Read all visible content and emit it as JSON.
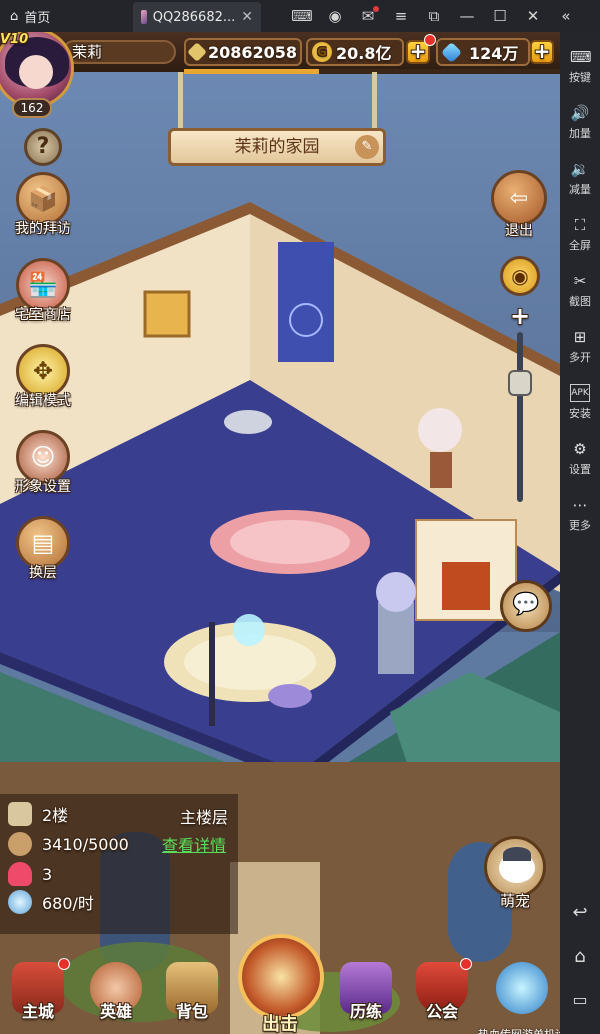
{
  "emulator": {
    "home_label": "首页",
    "tab_title": "QQ286682...",
    "tab_close": "✕",
    "window_icons": [
      "gamepad-icon",
      "user-icon",
      "mail-icon",
      "menu-icon",
      "popout-icon",
      "minimize-icon",
      "maximize-icon",
      "close-icon",
      "collapse-icon"
    ],
    "side_items": [
      {
        "label": "按键",
        "icon": "keyboard-icon"
      },
      {
        "label": "加量",
        "icon": "volume-up-icon"
      },
      {
        "label": "减量",
        "icon": "volume-down-icon"
      },
      {
        "label": "全屏",
        "icon": "fullscreen-icon"
      },
      {
        "label": "截图",
        "icon": "scissors-icon"
      },
      {
        "label": "多开",
        "icon": "multi-instance-icon"
      },
      {
        "label": "安装",
        "icon": "apk-icon"
      },
      {
        "label": "设置",
        "icon": "gear-icon"
      },
      {
        "label": "更多",
        "icon": "more-icon"
      }
    ],
    "nav_icons": [
      "back-icon",
      "home-icon",
      "recent-apps-icon"
    ]
  },
  "player": {
    "vip": "V10",
    "name": "茉莉",
    "level": "162",
    "power": "20862058",
    "gold": "20.8亿",
    "gems": "124万",
    "xp_fraction": 0.36
  },
  "room": {
    "title": "茉莉的家园"
  },
  "left_menu": [
    {
      "label": "我的拜访",
      "icon": "visit-icon"
    },
    {
      "label": "宅室商店",
      "icon": "shop-icon"
    },
    {
      "label": "编辑模式",
      "icon": "move-arrows-icon"
    },
    {
      "label": "形象设置",
      "icon": "portrait-icon"
    },
    {
      "label": "换层",
      "icon": "stairs-icon"
    }
  ],
  "right_controls": {
    "exit_label": "退出",
    "zoom_plus": "+",
    "zoom_fraction": 0.7
  },
  "floor_info": {
    "floor": "2楼",
    "floor_type": "主楼层",
    "capacity": "3410/5000",
    "detail_link": "查看详情",
    "hearts": "3",
    "rate": "680/时"
  },
  "pet": {
    "label": "萌宠"
  },
  "bottom_nav": [
    {
      "label": "主城"
    },
    {
      "label": "英雄"
    },
    {
      "label": "背包"
    },
    {
      "label": "出击"
    },
    {
      "label": "历练"
    },
    {
      "label": "公会"
    },
    {
      "label": ""
    }
  ],
  "watermark": "热血传网游单机论坛 www.rexuexia.com",
  "colors": {
    "floor": "#3a3e8f",
    "wall": "#f0dfc4",
    "roof": "#3f7a6c",
    "accent_gold": "#e9a732"
  }
}
